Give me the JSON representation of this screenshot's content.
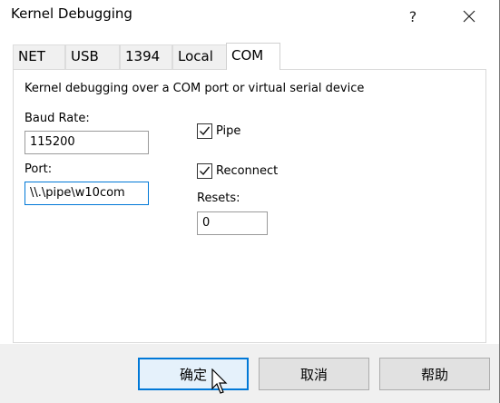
{
  "window": {
    "title": "Kernel Debugging",
    "help_glyph": "?",
    "close_glyph": "✕"
  },
  "tabs": [
    {
      "label": "NET"
    },
    {
      "label": "USB"
    },
    {
      "label": "1394"
    },
    {
      "label": "Local"
    },
    {
      "label": "COM",
      "active": true
    }
  ],
  "panel": {
    "description": "Kernel debugging over a COM port or virtual serial device",
    "baud_rate": {
      "label": "Baud Rate:",
      "value": "115200"
    },
    "port": {
      "label": "Port:",
      "value": "\\\\.\\pipe\\w10com"
    },
    "pipe": {
      "label": "Pipe",
      "checked": true
    },
    "reconnect": {
      "label": "Reconnect",
      "checked": true
    },
    "resets": {
      "label": "Resets:",
      "value": "0"
    }
  },
  "buttons": {
    "ok": "确定",
    "cancel": "取消",
    "help": "帮助"
  },
  "colors": {
    "focus_accent": "#0078d7",
    "footer_bg": "#f0f0f0"
  }
}
